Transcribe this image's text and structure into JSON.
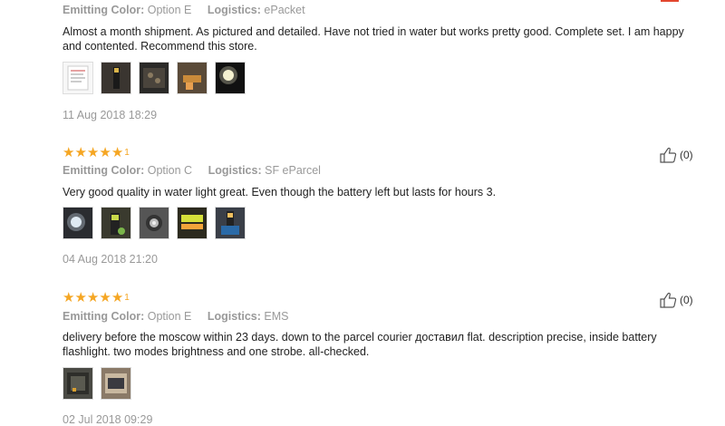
{
  "colors": {
    "accent": "#e2472f",
    "star": "#f5a623"
  },
  "labels": {
    "emitting_color": "Emitting Color:",
    "logistics": "Logistics:"
  },
  "reviews": [
    {
      "color_value": "Option E",
      "logistics_value": "ePacket",
      "text": "Almost a month shipment. As pictured and detailed. Have not tried in water but works pretty good. Complete set. I am happy and contented. Recommend this store.",
      "date": "11 Aug 2018 18:29",
      "photos": [
        "receipt-photo",
        "flashlight-photo",
        "flashlight-photo",
        "flashlight-photo",
        "flashlight-photo"
      ]
    },
    {
      "rating": 5,
      "star_suffix": "1",
      "helpful_count": "(0)",
      "color_value": "Option C",
      "logistics_value": "SF eParcel",
      "text": "Very good quality in water light great. Even though the battery left but lasts for hours 3.",
      "date": "04 Aug 2018 21:20",
      "photos": [
        "flashlight-photo",
        "flashlight-photo",
        "flashlight-photo",
        "flashlight-photo",
        "flashlight-photo"
      ]
    },
    {
      "rating": 5,
      "star_suffix": "1",
      "helpful_count": "(0)",
      "color_value": "Option E",
      "logistics_value": "EMS",
      "text": "delivery before the moscow within 23 days. down to the parcel courier доставил flat. description precise, inside battery flashlight. two modes brightness and one strobe. all-checked.",
      "date": "02 Jul 2018 09:29",
      "photos": [
        "package-photo",
        "package-photo"
      ]
    }
  ]
}
